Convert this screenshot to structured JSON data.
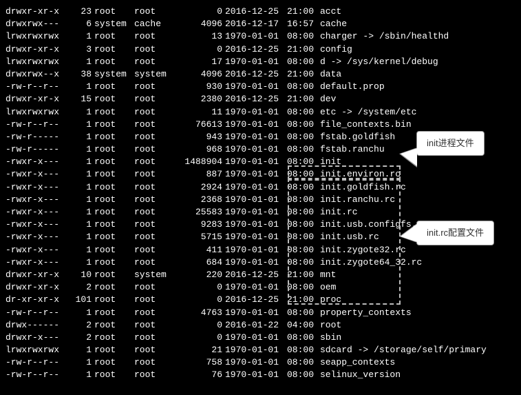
{
  "rows": [
    {
      "perms": "drwxr-xr-x",
      "links": "23",
      "owner": "root",
      "group": "root",
      "size": "0",
      "date": "2016-12-25",
      "time": "21:00",
      "name": "acct"
    },
    {
      "perms": "drwxrwx---",
      "links": "6",
      "owner": "system",
      "group": "cache",
      "size": "4096",
      "date": "2016-12-17",
      "time": "16:57",
      "name": "cache"
    },
    {
      "perms": "lrwxrwxrwx",
      "links": "1",
      "owner": "root",
      "group": "root",
      "size": "13",
      "date": "1970-01-01",
      "time": "08:00",
      "name": "charger -> /sbin/healthd"
    },
    {
      "perms": "drwxr-xr-x",
      "links": "3",
      "owner": "root",
      "group": "root",
      "size": "0",
      "date": "2016-12-25",
      "time": "21:00",
      "name": "config"
    },
    {
      "perms": "lrwxrwxrwx",
      "links": "1",
      "owner": "root",
      "group": "root",
      "size": "17",
      "date": "1970-01-01",
      "time": "08:00",
      "name": "d -> /sys/kernel/debug"
    },
    {
      "perms": "drwxrwx--x",
      "links": "38",
      "owner": "system",
      "group": "system",
      "size": "4096",
      "date": "2016-12-25",
      "time": "21:00",
      "name": "data"
    },
    {
      "perms": "-rw-r--r--",
      "links": "1",
      "owner": "root",
      "group": "root",
      "size": "930",
      "date": "1970-01-01",
      "time": "08:00",
      "name": "default.prop"
    },
    {
      "perms": "drwxr-xr-x",
      "links": "15",
      "owner": "root",
      "group": "root",
      "size": "2380",
      "date": "2016-12-25",
      "time": "21:00",
      "name": "dev"
    },
    {
      "perms": "lrwxrwxrwx",
      "links": "1",
      "owner": "root",
      "group": "root",
      "size": "11",
      "date": "1970-01-01",
      "time": "08:00",
      "name": "etc -> /system/etc"
    },
    {
      "perms": "-rw-r--r--",
      "links": "1",
      "owner": "root",
      "group": "root",
      "size": "76613",
      "date": "1970-01-01",
      "time": "08:00",
      "name": "file_contexts.bin"
    },
    {
      "perms": "-rw-r-----",
      "links": "1",
      "owner": "root",
      "group": "root",
      "size": "943",
      "date": "1970-01-01",
      "time": "08:00",
      "name": "fstab.goldfish"
    },
    {
      "perms": "-rw-r-----",
      "links": "1",
      "owner": "root",
      "group": "root",
      "size": "968",
      "date": "1970-01-01",
      "time": "08:00",
      "name": "fstab.ranchu"
    },
    {
      "perms": "-rwxr-x---",
      "links": "1",
      "owner": "root",
      "group": "root",
      "size": "1488904",
      "date": "1970-01-01",
      "time": "08:00",
      "name": "init"
    },
    {
      "perms": "-rwxr-x---",
      "links": "1",
      "owner": "root",
      "group": "root",
      "size": "887",
      "date": "1970-01-01",
      "time": "08:00",
      "name": "init.environ.rc"
    },
    {
      "perms": "-rwxr-x---",
      "links": "1",
      "owner": "root",
      "group": "root",
      "size": "2924",
      "date": "1970-01-01",
      "time": "08:00",
      "name": "init.goldfish.rc"
    },
    {
      "perms": "-rwxr-x---",
      "links": "1",
      "owner": "root",
      "group": "root",
      "size": "2368",
      "date": "1970-01-01",
      "time": "08:00",
      "name": "init.ranchu.rc"
    },
    {
      "perms": "-rwxr-x---",
      "links": "1",
      "owner": "root",
      "group": "root",
      "size": "25583",
      "date": "1970-01-01",
      "time": "08:00",
      "name": "init.rc"
    },
    {
      "perms": "-rwxr-x---",
      "links": "1",
      "owner": "root",
      "group": "root",
      "size": "9283",
      "date": "1970-01-01",
      "time": "08:00",
      "name": "init.usb.configfs.rc"
    },
    {
      "perms": "-rwxr-x---",
      "links": "1",
      "owner": "root",
      "group": "root",
      "size": "5715",
      "date": "1970-01-01",
      "time": "08:00",
      "name": "init.usb.rc"
    },
    {
      "perms": "-rwxr-x---",
      "links": "1",
      "owner": "root",
      "group": "root",
      "size": "411",
      "date": "1970-01-01",
      "time": "08:00",
      "name": "init.zygote32.rc"
    },
    {
      "perms": "-rwxr-x---",
      "links": "1",
      "owner": "root",
      "group": "root",
      "size": "684",
      "date": "1970-01-01",
      "time": "08:00",
      "name": "init.zygote64_32.rc"
    },
    {
      "perms": "drwxr-xr-x",
      "links": "10",
      "owner": "root",
      "group": "system",
      "size": "220",
      "date": "2016-12-25",
      "time": "21:00",
      "name": "mnt"
    },
    {
      "perms": "drwxr-xr-x",
      "links": "2",
      "owner": "root",
      "group": "root",
      "size": "0",
      "date": "1970-01-01",
      "time": "08:00",
      "name": "oem"
    },
    {
      "perms": "dr-xr-xr-x",
      "links": "101",
      "owner": "root",
      "group": "root",
      "size": "0",
      "date": "2016-12-25",
      "time": "21:00",
      "name": "proc"
    },
    {
      "perms": "-rw-r--r--",
      "links": "1",
      "owner": "root",
      "group": "root",
      "size": "4763",
      "date": "1970-01-01",
      "time": "08:00",
      "name": "property_contexts"
    },
    {
      "perms": "drwx------",
      "links": "2",
      "owner": "root",
      "group": "root",
      "size": "0",
      "date": "2016-01-22",
      "time": "04:00",
      "name": "root"
    },
    {
      "perms": "drwxr-x---",
      "links": "2",
      "owner": "root",
      "group": "root",
      "size": "0",
      "date": "1970-01-01",
      "time": "08:00",
      "name": "sbin"
    },
    {
      "perms": "lrwxrwxrwx",
      "links": "1",
      "owner": "root",
      "group": "root",
      "size": "21",
      "date": "1970-01-01",
      "time": "08:00",
      "name": "sdcard -> /storage/self/primary"
    },
    {
      "perms": "-rw-r--r--",
      "links": "1",
      "owner": "root",
      "group": "root",
      "size": "758",
      "date": "1970-01-01",
      "time": "08:00",
      "name": "seapp_contexts"
    },
    {
      "perms": "-rw-r--r--",
      "links": "1",
      "owner": "root",
      "group": "root",
      "size": "76",
      "date": "1970-01-01",
      "time": "08:00",
      "name": "selinux_version"
    }
  ],
  "callout1": "init进程文件",
  "callout2": "init.rc配置文件"
}
